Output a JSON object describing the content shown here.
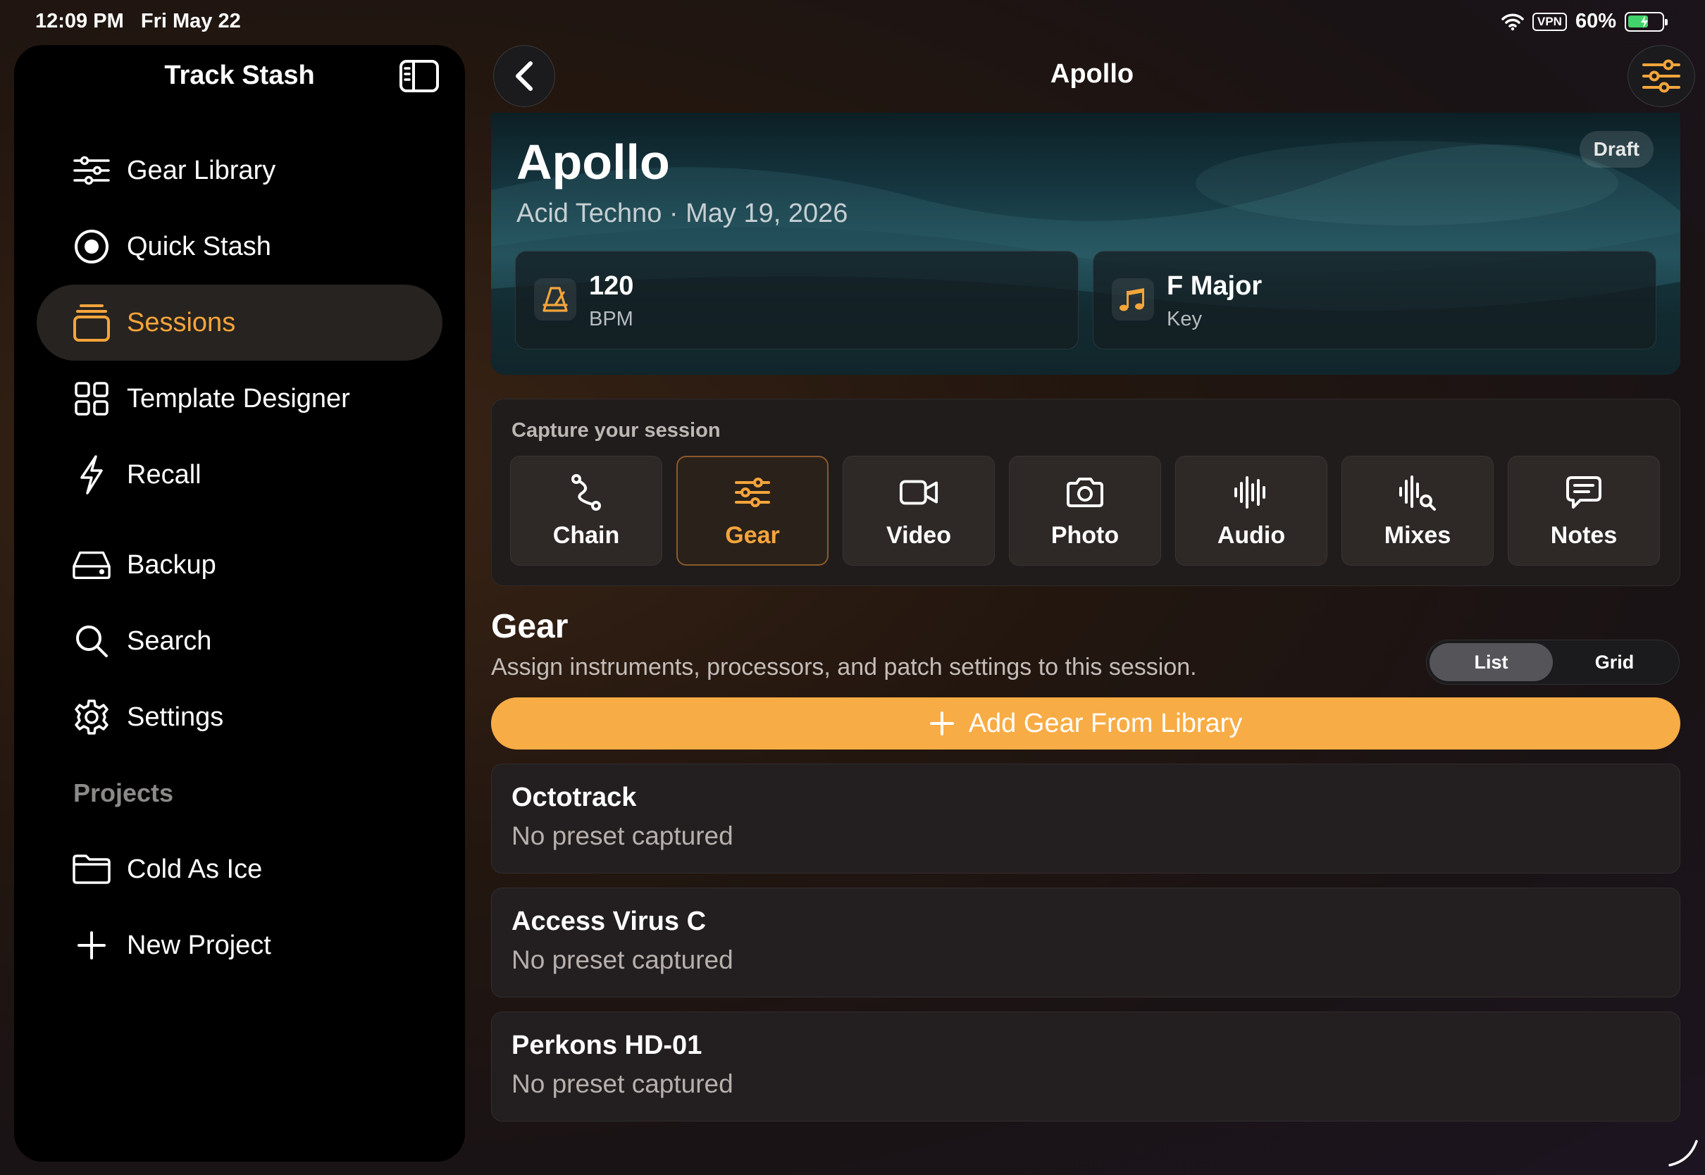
{
  "status": {
    "time": "12:09 PM",
    "date": "Fri May 22",
    "vpn": "VPN",
    "battery": "60%",
    "battery_level": 0.6
  },
  "sidebar": {
    "title": "Track Stash",
    "items": [
      {
        "label": "Gear Library",
        "icon": "sliders-icon"
      },
      {
        "label": "Quick Stash",
        "icon": "record-icon"
      },
      {
        "label": "Sessions",
        "icon": "stack-icon",
        "active": true
      },
      {
        "label": "Template Designer",
        "icon": "grid-icon"
      },
      {
        "label": "Recall",
        "icon": "bolt-icon"
      },
      {
        "label": "Backup",
        "icon": "drive-icon"
      },
      {
        "label": "Search",
        "icon": "search-icon"
      },
      {
        "label": "Settings",
        "icon": "gear-icon"
      }
    ],
    "projects_header": "Projects",
    "projects": [
      {
        "label": "Cold As Ice",
        "icon": "folder-icon"
      },
      {
        "label": "New Project",
        "icon": "plus-icon"
      }
    ]
  },
  "header": {
    "title": "Apollo"
  },
  "hero": {
    "title": "Apollo",
    "subtitle": "Acid Techno · May 19, 2026",
    "badge": "Draft",
    "bpm_value": "120",
    "bpm_label": "BPM",
    "key_value": "F Major",
    "key_label": "Key"
  },
  "capture": {
    "label": "Capture your session",
    "tiles": [
      {
        "label": "Chain",
        "icon": "chain-icon"
      },
      {
        "label": "Gear",
        "icon": "sliders-icon",
        "active": true
      },
      {
        "label": "Video",
        "icon": "video-icon"
      },
      {
        "label": "Photo",
        "icon": "camera-icon"
      },
      {
        "label": "Audio",
        "icon": "waveform-icon"
      },
      {
        "label": "Mixes",
        "icon": "waveform-search-icon"
      },
      {
        "label": "Notes",
        "icon": "speech-bubble-icon"
      }
    ]
  },
  "gear": {
    "title": "Gear",
    "description": "Assign instruments, processors, and patch settings to this session.",
    "view_list": "List",
    "view_grid": "Grid",
    "add_label": "Add Gear From Library",
    "items": [
      {
        "name": "Octotrack",
        "preset": "No preset captured"
      },
      {
        "name": "Access Virus C",
        "preset": "No preset captured"
      },
      {
        "name": "Perkons HD-01",
        "preset": "No preset captured"
      }
    ]
  },
  "colors": {
    "accent": "#f5a53c",
    "button": "#f8ac45",
    "battery": "#41d26b"
  }
}
